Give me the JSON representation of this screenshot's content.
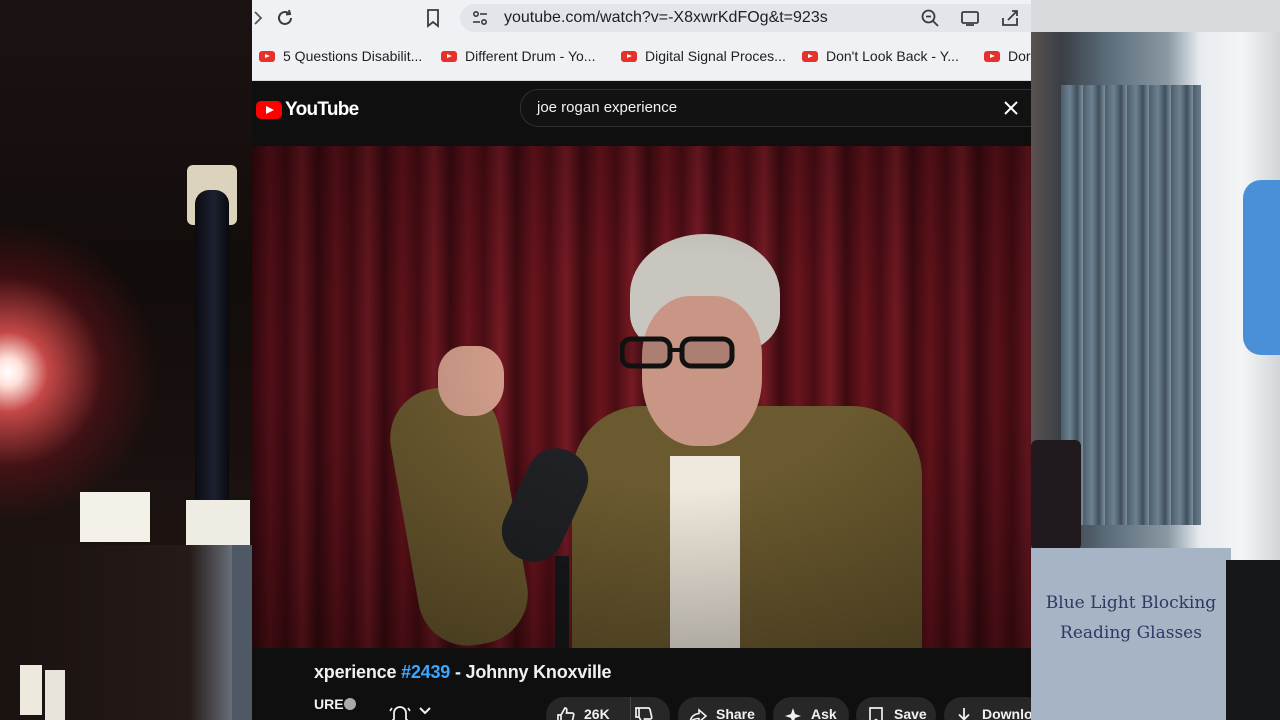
{
  "browser": {
    "address_url": "youtube.com/watch?v=-X8xwrKdFOg&t=923s",
    "bookmarks": [
      {
        "label": "5 Questions Disabilit..."
      },
      {
        "label": "Different Drum - Yo..."
      },
      {
        "label": "Digital Signal Proces..."
      },
      {
        "label": "Don't Look Back - Y..."
      },
      {
        "label": "Dor"
      }
    ]
  },
  "youtube": {
    "logo_text": "YouTube",
    "search_query": "joe rogan experience",
    "video": {
      "title_prefix": "xperience",
      "episode_tag": "#2439",
      "title_suffix": "- Johnny Knoxville",
      "channel_partial": "URE"
    },
    "actions": {
      "like_count": "26K",
      "share_label": "Share",
      "ask_label": "Ask",
      "save_label": "Save",
      "download_label": "Downlo"
    }
  },
  "webcam_overlay": {
    "box_text_line1": "Blue Light Blocking",
    "box_text_line2": "Reading Glasses"
  }
}
